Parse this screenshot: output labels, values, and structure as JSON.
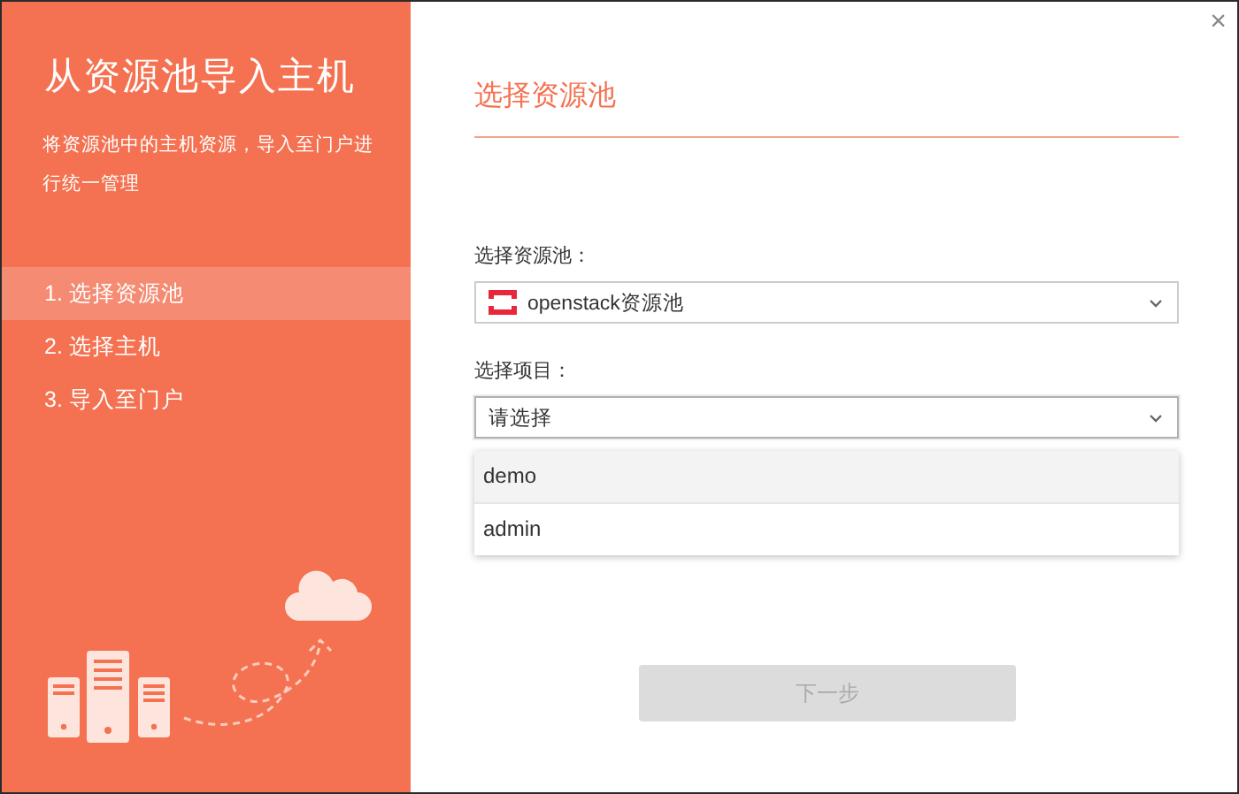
{
  "sidebar": {
    "title": "从资源池导入主机",
    "description": "将资源池中的主机资源，导入至门户进行统一管理",
    "steps": [
      {
        "label": "1. 选择资源池",
        "selected": true
      },
      {
        "label": "2. 选择主机",
        "selected": false
      },
      {
        "label": "3. 导入至门户",
        "selected": false
      }
    ]
  },
  "close": "×",
  "section_title": "选择资源池",
  "fields": [
    {
      "label": "选择资源池：",
      "value": "openstack资源池",
      "expanded": false
    },
    {
      "label": "选择项目：",
      "placeholder": "请选择",
      "expanded": true,
      "options": [
        {
          "label": "demo",
          "selected": true
        },
        {
          "label": "admin",
          "selected": false
        }
      ]
    }
  ],
  "next_button": {
    "label": "下一步",
    "disabled": true
  }
}
